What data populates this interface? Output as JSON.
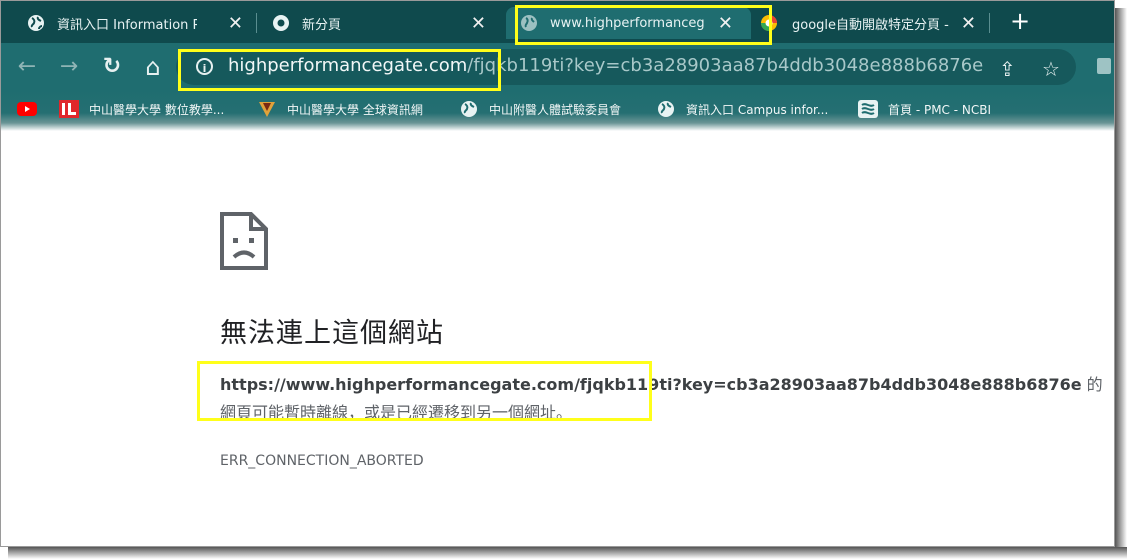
{
  "tabs": [
    {
      "title": "資訊入口 Information Portal",
      "close": "✕",
      "icon": "globe-icon"
    },
    {
      "title": "新分頁",
      "close": "✕",
      "icon": "chrome-icon"
    },
    {
      "title": "www.highperformancegate.com",
      "close": "✕",
      "icon": "loading-globe-icon",
      "active": true
    },
    {
      "title": "google自動開啟特定分頁 -",
      "close": "✕",
      "icon": "google-icon"
    }
  ],
  "new_tab": "+",
  "toolbar": {
    "back": "←",
    "forward": "→",
    "reload": "↻",
    "home": "⌂",
    "url_host": "highperformancegate.com",
    "url_path": "/fjqkb119ti?key=cb3a28903aa87b4ddb3048e888b6876e",
    "share": "⇪",
    "star": "☆"
  },
  "bookmarks": [
    {
      "label": "",
      "icon": "youtube-icon"
    },
    {
      "label": "中山醫學大學 數位教學...",
      "icon": "ilearn-icon"
    },
    {
      "label": "中山醫學大學 全球資訊網",
      "icon": "csmu-logo-icon"
    },
    {
      "label": "中山附醫人體試驗委員會",
      "icon": "globe-icon"
    },
    {
      "label": "資訊入口 Campus infor...",
      "icon": "globe-icon"
    },
    {
      "label": "首頁 - PMC - NCBI",
      "icon": "ncbi-icon"
    }
  ],
  "error": {
    "title": "無法連上這個網站",
    "url": "https://www.highperformancegate.com/fjqkb119ti?key=cb3a28903aa87b4ddb3048e888b6876e",
    "desc_suffix": " 的網頁可能暫時離線，或是已經遷移到另一個網址。",
    "code": "ERR_CONNECTION_ABORTED"
  },
  "colors": {
    "tab_bg": "#0f4a4d",
    "toolbar_bg": "#1f6d70",
    "highlight": "#ffff1a"
  }
}
